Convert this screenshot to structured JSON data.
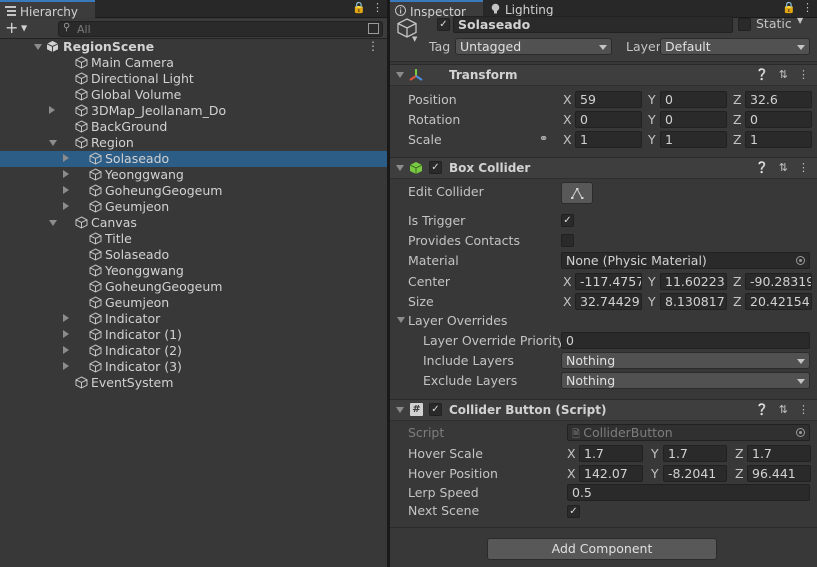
{
  "hierarchy": {
    "tab_label": "Hierarchy",
    "add_label": "+",
    "search_placeholder": "All",
    "items": [
      {
        "label": "RegionScene"
      },
      {
        "label": "Main Camera"
      },
      {
        "label": "Directional Light"
      },
      {
        "label": "Global Volume"
      },
      {
        "label": "3DMap_Jeollanam_Do"
      },
      {
        "label": "BackGround"
      },
      {
        "label": "Region"
      },
      {
        "label": "Solaseado"
      },
      {
        "label": "Yeonggwang"
      },
      {
        "label": "GoheungGeogeum"
      },
      {
        "label": "Geumjeon"
      },
      {
        "label": "Canvas"
      },
      {
        "label": "Title"
      },
      {
        "label": "Solaseado"
      },
      {
        "label": "Yeonggwang"
      },
      {
        "label": "GoheungGeogeum"
      },
      {
        "label": "Geumjeon"
      },
      {
        "label": "Indicator"
      },
      {
        "label": "Indicator (1)"
      },
      {
        "label": "Indicator (2)"
      },
      {
        "label": "Indicator (3)"
      },
      {
        "label": "EventSystem"
      }
    ],
    "selected": "Solaseado"
  },
  "inspector": {
    "tabs": [
      {
        "label": "Inspector"
      },
      {
        "label": "Lighting"
      }
    ],
    "object_name": "Solaseado",
    "static_label": "Static",
    "tag_label": "Tag",
    "tag_value": "Untagged",
    "layer_label": "Layer",
    "layer_value": "Default",
    "transform": {
      "title": "Transform",
      "position": {
        "label": "Position",
        "x": "59",
        "y": "0",
        "z": "32.6"
      },
      "rotation": {
        "label": "Rotation",
        "x": "0",
        "y": "0",
        "z": "0"
      },
      "scale": {
        "label": "Scale",
        "x": "1",
        "y": "1",
        "z": "1"
      }
    },
    "box_collider": {
      "title": "Box Collider",
      "edit_collider": "Edit Collider",
      "is_trigger": "Is Trigger",
      "is_trigger_checked": true,
      "provides_contacts": "Provides Contacts",
      "material_label": "Material",
      "material_value": "None (Physic Material)",
      "center": {
        "label": "Center",
        "x": "-117.4757",
        "y": "11.60223",
        "z": "-90.28319"
      },
      "size": {
        "label": "Size",
        "x": "32.74429",
        "y": "8.130817",
        "z": "20.42154"
      },
      "layer_overrides": "Layer Overrides",
      "layer_override_priority": {
        "label": "Layer Override Priority",
        "value": "0"
      },
      "include_layers": {
        "label": "Include Layers",
        "value": "Nothing"
      },
      "exclude_layers": {
        "label": "Exclude Layers",
        "value": "Nothing"
      }
    },
    "collider_button": {
      "title": "Collider Button (Script)",
      "script_label": "Script",
      "script_value": "ColliderButton",
      "hover_scale": {
        "label": "Hover Scale",
        "x": "1.7",
        "y": "1.7",
        "z": "1.7"
      },
      "hover_position": {
        "label": "Hover Position",
        "x": "142.07",
        "y": "-8.2041",
        "z": "96.441"
      },
      "lerp_speed": {
        "label": "Lerp Speed",
        "value": "0.5"
      },
      "next_scene": {
        "label": "Next Scene",
        "checked": true
      }
    },
    "add_component": "Add Component"
  },
  "axes": {
    "x": "X",
    "y": "Y",
    "z": "Z"
  }
}
